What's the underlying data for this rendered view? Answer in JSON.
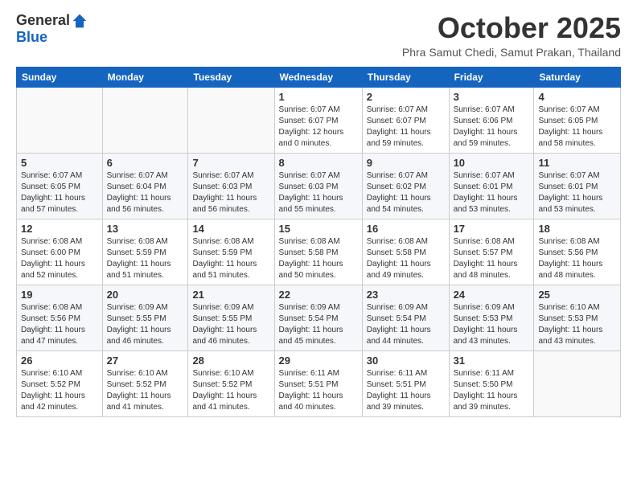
{
  "logo": {
    "general": "General",
    "blue": "Blue"
  },
  "header": {
    "month": "October 2025",
    "location": "Phra Samut Chedi, Samut Prakan, Thailand"
  },
  "weekdays": [
    "Sunday",
    "Monday",
    "Tuesday",
    "Wednesday",
    "Thursday",
    "Friday",
    "Saturday"
  ],
  "weeks": [
    [
      {
        "day": "",
        "info": ""
      },
      {
        "day": "",
        "info": ""
      },
      {
        "day": "",
        "info": ""
      },
      {
        "day": "1",
        "info": "Sunrise: 6:07 AM\nSunset: 6:07 PM\nDaylight: 12 hours\nand 0 minutes."
      },
      {
        "day": "2",
        "info": "Sunrise: 6:07 AM\nSunset: 6:07 PM\nDaylight: 11 hours\nand 59 minutes."
      },
      {
        "day": "3",
        "info": "Sunrise: 6:07 AM\nSunset: 6:06 PM\nDaylight: 11 hours\nand 59 minutes."
      },
      {
        "day": "4",
        "info": "Sunrise: 6:07 AM\nSunset: 6:05 PM\nDaylight: 11 hours\nand 58 minutes."
      }
    ],
    [
      {
        "day": "5",
        "info": "Sunrise: 6:07 AM\nSunset: 6:05 PM\nDaylight: 11 hours\nand 57 minutes."
      },
      {
        "day": "6",
        "info": "Sunrise: 6:07 AM\nSunset: 6:04 PM\nDaylight: 11 hours\nand 56 minutes."
      },
      {
        "day": "7",
        "info": "Sunrise: 6:07 AM\nSunset: 6:03 PM\nDaylight: 11 hours\nand 56 minutes."
      },
      {
        "day": "8",
        "info": "Sunrise: 6:07 AM\nSunset: 6:03 PM\nDaylight: 11 hours\nand 55 minutes."
      },
      {
        "day": "9",
        "info": "Sunrise: 6:07 AM\nSunset: 6:02 PM\nDaylight: 11 hours\nand 54 minutes."
      },
      {
        "day": "10",
        "info": "Sunrise: 6:07 AM\nSunset: 6:01 PM\nDaylight: 11 hours\nand 53 minutes."
      },
      {
        "day": "11",
        "info": "Sunrise: 6:07 AM\nSunset: 6:01 PM\nDaylight: 11 hours\nand 53 minutes."
      }
    ],
    [
      {
        "day": "12",
        "info": "Sunrise: 6:08 AM\nSunset: 6:00 PM\nDaylight: 11 hours\nand 52 minutes."
      },
      {
        "day": "13",
        "info": "Sunrise: 6:08 AM\nSunset: 5:59 PM\nDaylight: 11 hours\nand 51 minutes."
      },
      {
        "day": "14",
        "info": "Sunrise: 6:08 AM\nSunset: 5:59 PM\nDaylight: 11 hours\nand 51 minutes."
      },
      {
        "day": "15",
        "info": "Sunrise: 6:08 AM\nSunset: 5:58 PM\nDaylight: 11 hours\nand 50 minutes."
      },
      {
        "day": "16",
        "info": "Sunrise: 6:08 AM\nSunset: 5:58 PM\nDaylight: 11 hours\nand 49 minutes."
      },
      {
        "day": "17",
        "info": "Sunrise: 6:08 AM\nSunset: 5:57 PM\nDaylight: 11 hours\nand 48 minutes."
      },
      {
        "day": "18",
        "info": "Sunrise: 6:08 AM\nSunset: 5:56 PM\nDaylight: 11 hours\nand 48 minutes."
      }
    ],
    [
      {
        "day": "19",
        "info": "Sunrise: 6:08 AM\nSunset: 5:56 PM\nDaylight: 11 hours\nand 47 minutes."
      },
      {
        "day": "20",
        "info": "Sunrise: 6:09 AM\nSunset: 5:55 PM\nDaylight: 11 hours\nand 46 minutes."
      },
      {
        "day": "21",
        "info": "Sunrise: 6:09 AM\nSunset: 5:55 PM\nDaylight: 11 hours\nand 46 minutes."
      },
      {
        "day": "22",
        "info": "Sunrise: 6:09 AM\nSunset: 5:54 PM\nDaylight: 11 hours\nand 45 minutes."
      },
      {
        "day": "23",
        "info": "Sunrise: 6:09 AM\nSunset: 5:54 PM\nDaylight: 11 hours\nand 44 minutes."
      },
      {
        "day": "24",
        "info": "Sunrise: 6:09 AM\nSunset: 5:53 PM\nDaylight: 11 hours\nand 43 minutes."
      },
      {
        "day": "25",
        "info": "Sunrise: 6:10 AM\nSunset: 5:53 PM\nDaylight: 11 hours\nand 43 minutes."
      }
    ],
    [
      {
        "day": "26",
        "info": "Sunrise: 6:10 AM\nSunset: 5:52 PM\nDaylight: 11 hours\nand 42 minutes."
      },
      {
        "day": "27",
        "info": "Sunrise: 6:10 AM\nSunset: 5:52 PM\nDaylight: 11 hours\nand 41 minutes."
      },
      {
        "day": "28",
        "info": "Sunrise: 6:10 AM\nSunset: 5:52 PM\nDaylight: 11 hours\nand 41 minutes."
      },
      {
        "day": "29",
        "info": "Sunrise: 6:11 AM\nSunset: 5:51 PM\nDaylight: 11 hours\nand 40 minutes."
      },
      {
        "day": "30",
        "info": "Sunrise: 6:11 AM\nSunset: 5:51 PM\nDaylight: 11 hours\nand 39 minutes."
      },
      {
        "day": "31",
        "info": "Sunrise: 6:11 AM\nSunset: 5:50 PM\nDaylight: 11 hours\nand 39 minutes."
      },
      {
        "day": "",
        "info": ""
      }
    ]
  ]
}
